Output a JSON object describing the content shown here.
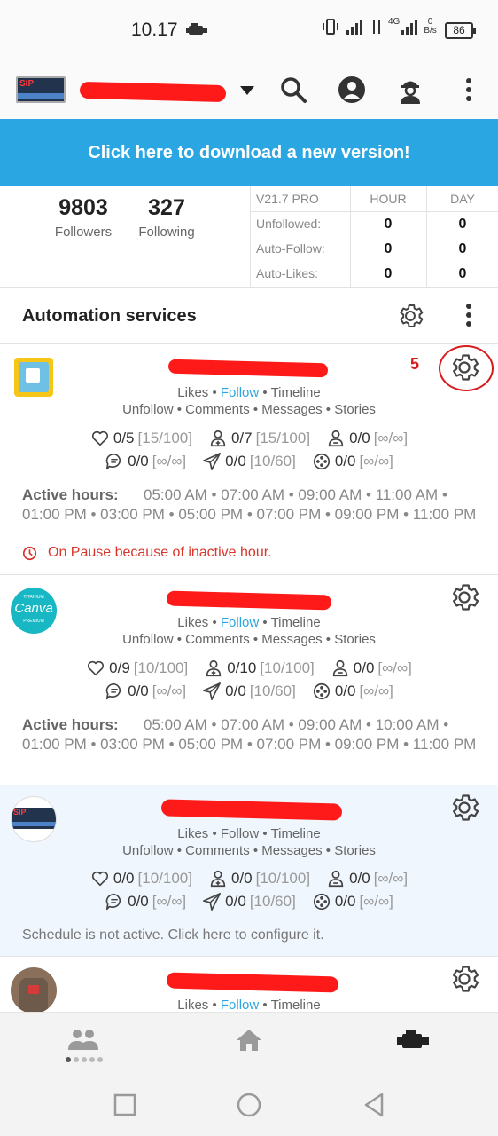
{
  "status_bar": {
    "time": "10.17",
    "network_label": "4G",
    "speed_value": "0",
    "speed_unit": "B/s",
    "battery": "86"
  },
  "app_bar": {
    "account_name": "",
    "icons": [
      "menu-dropdown-icon",
      "search-icon",
      "account-icon",
      "support-agent-icon",
      "more-vert-icon"
    ]
  },
  "banner": {
    "text": "Click here to download a new version!",
    "color": "#2aa7e2"
  },
  "stats": {
    "followers_value": "9803",
    "followers_label": "Followers",
    "following_value": "327",
    "following_label": "Following",
    "table": {
      "version": "V21.7 PRO",
      "col_hour": "HOUR",
      "col_day": "DAY",
      "rows": [
        {
          "label": "Unfollowed:",
          "hour": "0",
          "day": "0"
        },
        {
          "label": "Auto-Follow:",
          "hour": "0",
          "day": "0"
        },
        {
          "label": "Auto-Likes:",
          "hour": "0",
          "day": "0"
        }
      ]
    }
  },
  "section": {
    "title": "Automation services"
  },
  "annotation": {
    "number": "5",
    "color": "#d81b1b"
  },
  "cards": [
    {
      "services_line1": {
        "a": "Likes",
        "sep1": " • ",
        "b": "Follow",
        "sep2": " • ",
        "c": "Timeline"
      },
      "services_line2": "Unfollow • Comments • Messages • Stories",
      "limits_row1": [
        {
          "icon": "heart-icon",
          "value": "0/5",
          "max": "[15/100]"
        },
        {
          "icon": "person-add-icon",
          "value": "0/7",
          "max": "[15/100]"
        },
        {
          "icon": "person-remove-icon",
          "value": "0/0",
          "max": "[∞/∞]"
        }
      ],
      "limits_row2": [
        {
          "icon": "comment-icon",
          "value": "0/0",
          "max": "[∞/∞]"
        },
        {
          "icon": "send-icon",
          "value": "0/0",
          "max": "[10/60]"
        },
        {
          "icon": "film-reel-icon",
          "value": "0/0",
          "max": "[∞/∞]"
        }
      ],
      "active_label": "Active hours:",
      "active_hours": "05:00 AM • 07:00 AM • 09:00 AM • 11:00 AM • 01:00 PM • 03:00 PM • 05:00 PM • 07:00 PM • 09:00 PM • 11:00 PM",
      "pause_text": "On Pause because of inactive hour."
    },
    {
      "services_line1": {
        "a": "Likes",
        "sep1": " • ",
        "b": "Follow",
        "sep2": " • ",
        "c": "Timeline"
      },
      "services_line2": "Unfollow • Comments • Messages • Stories",
      "limits_row1": [
        {
          "icon": "heart-icon",
          "value": "0/9",
          "max": "[10/100]"
        },
        {
          "icon": "person-add-icon",
          "value": "0/10",
          "max": "[10/100]"
        },
        {
          "icon": "person-remove-icon",
          "value": "0/0",
          "max": "[∞/∞]"
        }
      ],
      "limits_row2": [
        {
          "icon": "comment-icon",
          "value": "0/0",
          "max": "[∞/∞]"
        },
        {
          "icon": "send-icon",
          "value": "0/0",
          "max": "[10/60]"
        },
        {
          "icon": "film-reel-icon",
          "value": "0/0",
          "max": "[∞/∞]"
        }
      ],
      "active_label": "Active hours:",
      "active_hours": "05:00 AM • 07:00 AM • 09:00 AM • 10:00 AM • 01:00 PM • 03:00 PM • 05:00 PM • 07:00 PM • 09:00 PM • 11:00 PM",
      "avatar_text_top": "TITANIUM",
      "avatar_text_mid": "Canva",
      "avatar_text_bot": "PREMIUM"
    },
    {
      "services_line1": {
        "a": "Likes",
        "sep1": " • ",
        "b": "Follow",
        "sep2": " • ",
        "c": "Timeline"
      },
      "services_line2": "Unfollow • Comments • Messages • Stories",
      "limits_row1": [
        {
          "icon": "heart-icon",
          "value": "0/0",
          "max": "[10/100]"
        },
        {
          "icon": "person-add-icon",
          "value": "0/0",
          "max": "[10/100]"
        },
        {
          "icon": "person-remove-icon",
          "value": "0/0",
          "max": "[∞/∞]"
        }
      ],
      "limits_row2": [
        {
          "icon": "comment-icon",
          "value": "0/0",
          "max": "[∞/∞]"
        },
        {
          "icon": "send-icon",
          "value": "0/0",
          "max": "[10/60]"
        },
        {
          "icon": "film-reel-icon",
          "value": "0/0",
          "max": "[∞/∞]"
        }
      ],
      "schedule_text": "Schedule is not active. Click here to configure it."
    },
    {
      "services_line1": {
        "a": "Likes",
        "sep1": " • ",
        "b": "Follow",
        "sep2": " • ",
        "c": "Timeline"
      }
    }
  ],
  "bottom_nav": {
    "items": [
      "people-icon",
      "home-icon",
      "engine-icon"
    ],
    "active": "engine-icon"
  },
  "system_nav": [
    "recents-square-icon",
    "home-circle-icon",
    "back-triangle-icon"
  ]
}
